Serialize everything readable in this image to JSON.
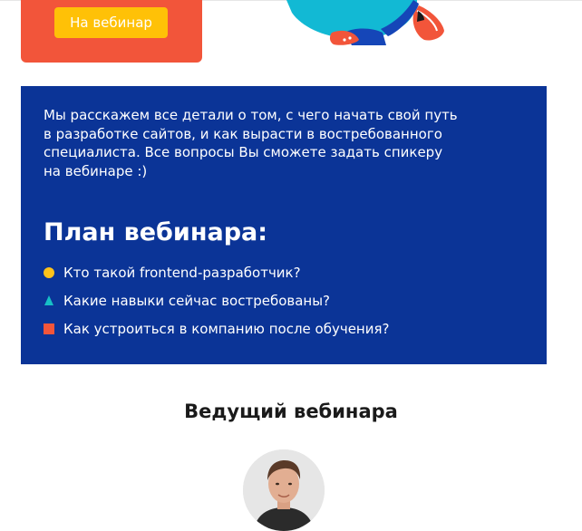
{
  "hero": {
    "cta_label": "На вебинар",
    "card_color": "#f2553a",
    "button_color": "#ffc107"
  },
  "info": {
    "background": "#0b3497",
    "intro_lines": [
      "Мы расскажем все детали о том, с чего начать свой путь",
      "в разработке сайтов, и как вырасти в востребованного",
      "специалиста. Все вопросы Вы сможете задать спикеру",
      "на вебинаре :)"
    ],
    "plan_title": "План вебинара:",
    "plan_items": [
      {
        "label": "Кто такой frontend-разработчик?",
        "icon": "yellow-circle-bullet",
        "color": "#ffc21a"
      },
      {
        "label": "Какие навыки сейчас востребованы?",
        "icon": "teal-triangle-bullet",
        "color": "#17bfc6"
      },
      {
        "label": "Как устроиться в компанию после обучения?",
        "icon": "red-square-bullet",
        "color": "#f2553a"
      }
    ]
  },
  "host": {
    "title": "Ведущий вебинара",
    "avatar_icon": "speaker-avatar"
  },
  "illustration": {
    "icon": "person-sneakers-illustration"
  }
}
